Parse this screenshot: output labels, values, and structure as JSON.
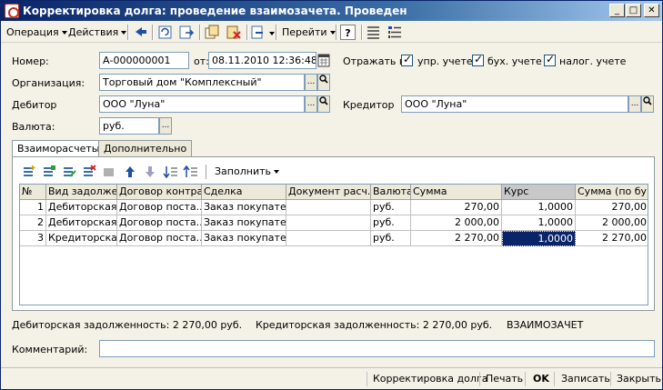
{
  "window": {
    "title": "Корректировка долга: проведение взаимозачета. Проведен",
    "minimize": "_",
    "maximize": "□",
    "close": "✕"
  },
  "toolbar": {
    "operation": "Операция",
    "actions": "Действия",
    "goto": "Перейти",
    "help": "?"
  },
  "form": {
    "number_label": "Номер:",
    "number_value": "А-000000001",
    "date_label": "от:",
    "date_value": "08.11.2010 12:36:48",
    "reflect_label": "Отражать в:",
    "mgmt_label": "упр. учете",
    "acct_label": "бух. учете",
    "tax_label": "налог. учете",
    "org_label": "Организация:",
    "org_value": "Торговый дом \"Комплексный\"",
    "debtor_label": "Дебитор",
    "debtor_value": "ООО \"Луна\"",
    "creditor_label": "Кредитор",
    "creditor_value": "ООО \"Луна\"",
    "currency_label": "Валюта:",
    "currency_value": "руб.",
    "ellipsis": "...",
    "magnifier": "🔍"
  },
  "tabs": [
    {
      "label": "Взаиморасчеты"
    },
    {
      "label": "Дополнительно"
    }
  ],
  "table_toolbar": {
    "fill": "Заполнить"
  },
  "table": {
    "headers": [
      "№",
      "Вид задолже...",
      "Договор контра...",
      "Сделка",
      "Документ расч...",
      "Валюта",
      "Сумма",
      "Курс",
      "Сумма (по бу..."
    ],
    "rows": [
      [
        "1",
        "Дебиторская",
        "Договор поста...",
        "Заказ покупате...",
        "",
        "руб.",
        "270,00",
        "1,0000",
        "270,00"
      ],
      [
        "2",
        "Дебиторская",
        "Договор поста...",
        "Заказ покупате...",
        "",
        "руб.",
        "2 000,00",
        "1,0000",
        "2 000,00"
      ],
      [
        "3",
        "Кредиторская",
        "Договор поста...",
        "Заказ покупате...",
        "",
        "руб.",
        "2 270,00",
        "1,0000",
        "2 270,00"
      ]
    ]
  },
  "summary": {
    "debit": "Дебиторская задолженность: 2 270,00 руб.",
    "credit": "Кредиторская задолженность: 2 270,00 руб.",
    "mode": "ВЗАИМОЗАЧЕТ"
  },
  "comment": {
    "label": "Комментарий:",
    "value": ""
  },
  "bottom_buttons": {
    "correction": "Корректировка долга",
    "print": "Печать",
    "ok": "OK",
    "save": "Записать",
    "close": "Закрыть"
  }
}
